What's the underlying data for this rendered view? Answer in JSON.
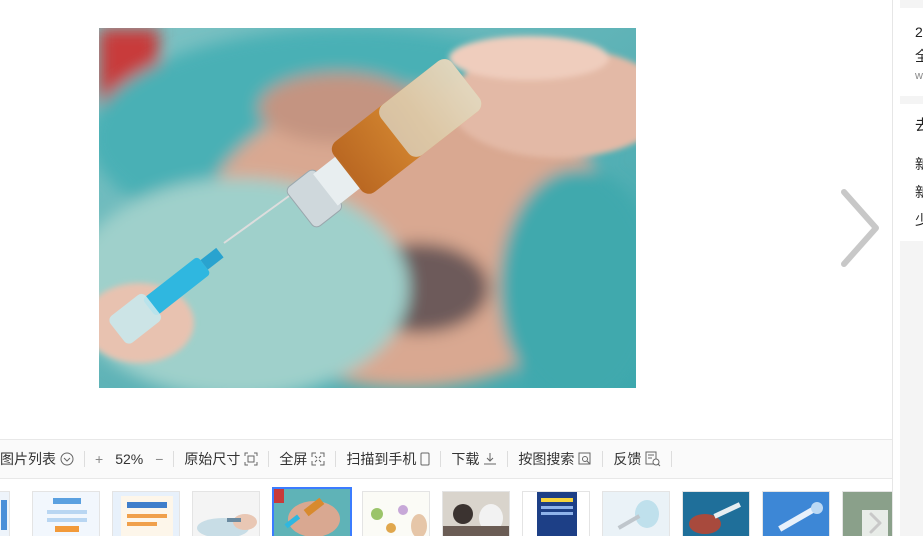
{
  "viewer": {
    "image": {
      "alt": "syringe and vaccine vial photo"
    }
  },
  "toolbar": {
    "list_label": "图片列表",
    "zoom_in": "+",
    "zoom_value": "52%",
    "zoom_out": "−",
    "original_size": "原始尺寸",
    "fullscreen": "全屏",
    "scan_to_phone": "扫描到手机",
    "download": "下载",
    "search_by_image": "按图搜索",
    "feedback": "反馈"
  },
  "right_panel": {
    "card1": {
      "line1": "2",
      "line2": "全",
      "url": "w"
    },
    "card2": {
      "title": "去",
      "items": [
        "新",
        "新",
        "少"
      ]
    }
  },
  "thumbnails": {
    "count": 12,
    "active_index": 3
  },
  "colors": {
    "accent": "#3b7cff",
    "toolbar_bg": "#fafafa"
  }
}
